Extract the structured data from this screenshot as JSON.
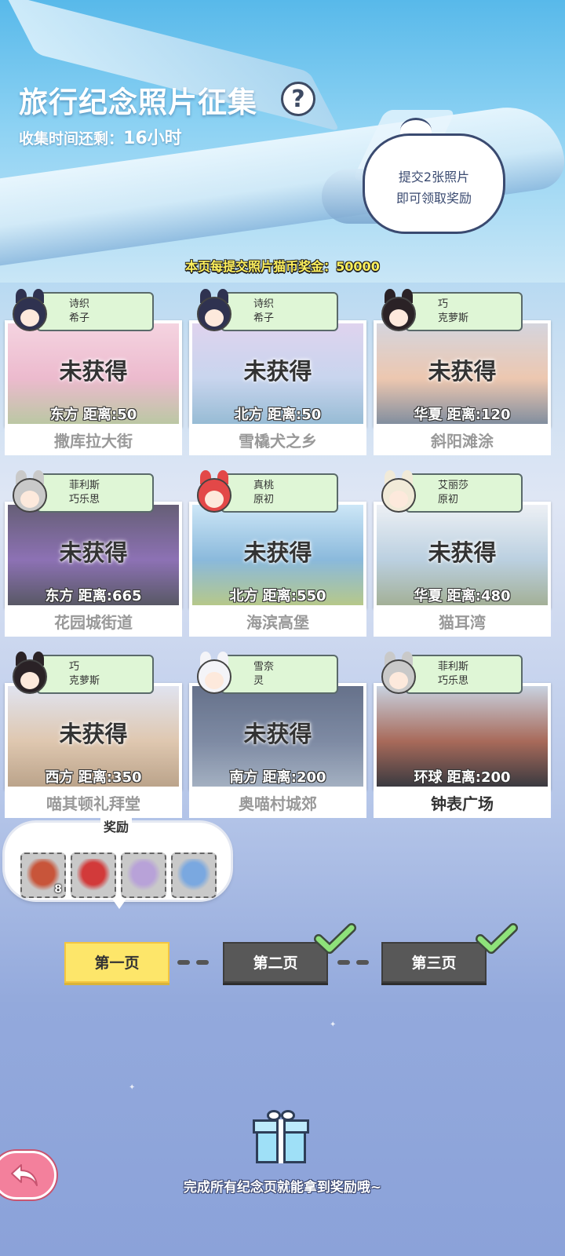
{
  "header": {
    "title": "旅行纪念照片征集",
    "help_icon": "?",
    "timer_label": "收集时间还剩：",
    "timer_value": "16小时",
    "speech_line1": "提交2张照片",
    "speech_line2": "即可领取奖励",
    "bonus_text": "本页每提交照片猫币奖金：50000"
  },
  "cards": [
    {
      "status": "未获得",
      "direction": "东方",
      "distance_label": "距离:50",
      "place": "撒库拉大街",
      "char_line1": "诗织",
      "char_line2": "希子",
      "scene_colors": [
        "#f2c8d8",
        "#e7a7c0",
        "#a8b88a"
      ],
      "hair": "#2f3250",
      "collected": false
    },
    {
      "status": "未获得",
      "direction": "北方",
      "distance_label": "距离:50",
      "place": "雪橇犬之乡",
      "char_line1": "诗织",
      "char_line2": "希子",
      "scene_colors": [
        "#d6c7ea",
        "#b9c9e9",
        "#7aa9c9"
      ],
      "hair": "#2f3250",
      "collected": false
    },
    {
      "status": "未获得",
      "direction": "华夏",
      "distance_label": "距离:120",
      "place": "斜阳滩涂",
      "char_line1": "巧",
      "char_line2": "克萝斯",
      "scene_colors": [
        "#c9c9d4",
        "#e8b89a",
        "#5f6f84"
      ],
      "hair": "#2a2226",
      "collected": false
    },
    {
      "status": "未获得",
      "direction": "东方",
      "distance_label": "距离:665",
      "place": "花园城街道",
      "char_line1": "菲利斯",
      "char_line2": "巧乐思",
      "scene_colors": [
        "#3b3250",
        "#6d4aa0",
        "#2a2a3a"
      ],
      "hair": "#c9c9c9",
      "collected": false
    },
    {
      "status": "未获得",
      "direction": "北方",
      "distance_label": "距离:550",
      "place": "海滨高堡",
      "char_line1": "真桃",
      "char_line2": "原初",
      "scene_colors": [
        "#bfe0f5",
        "#6aa6d2",
        "#a2b96a"
      ],
      "hair": "#e34848",
      "collected": false
    },
    {
      "status": "未获得",
      "direction": "华夏",
      "distance_label": "距离:480",
      "place": "猫耳湾",
      "char_line1": "艾丽莎",
      "char_line2": "原初",
      "scene_colors": [
        "#e8ecf2",
        "#a8c3d8",
        "#8a9a7a"
      ],
      "hair": "#f1ead8",
      "collected": false
    },
    {
      "status": "未获得",
      "direction": "西方",
      "distance_label": "距离:350",
      "place": "喵其顿礼拜堂",
      "char_line1": "巧",
      "char_line2": "克萝斯",
      "scene_colors": [
        "#d8dcec",
        "#d6b89a",
        "#a88a6a"
      ],
      "hair": "#2a2226",
      "collected": false
    },
    {
      "status": "未获得",
      "direction": "南方",
      "distance_label": "距离:200",
      "place": "奥喵村城郊",
      "char_line1": "雪奈",
      "char_line2": "灵",
      "scene_colors": [
        "#3b4a6a",
        "#5a6a8a",
        "#8a9ab0"
      ],
      "hair": "#f4f4f8",
      "collected": false
    },
    {
      "status": "",
      "direction": "环球",
      "distance_label": "距离:200",
      "place": "钟表广场",
      "char_line1": "菲利斯",
      "char_line2": "巧乐思",
      "scene_colors": [
        "#c8d2e0",
        "#a86a5a",
        "#3a3a40"
      ],
      "hair": "#c9c9c9",
      "collected": true
    }
  ],
  "reward": {
    "title": "奖励",
    "items": [
      {
        "icon": "basket-icon",
        "count": "8",
        "color": "#c8553a"
      },
      {
        "icon": "garland-icon",
        "count": "",
        "color": "#d23a3a"
      },
      {
        "icon": "stocking-icon",
        "count": "",
        "color": "#b8a2d8"
      },
      {
        "icon": "dress-icon",
        "count": "",
        "color": "#7aa8e0"
      }
    ]
  },
  "pages": [
    {
      "label": "第一页",
      "state": "active"
    },
    {
      "label": "第二页",
      "state": "done"
    },
    {
      "label": "第三页",
      "state": "done"
    }
  ],
  "footer_text": "完成所有纪念页就能拿到奖励哦~",
  "colors": {
    "accent_yellow": "#fde66a",
    "check_green": "#8ee27a",
    "back_pink": "#f3809c"
  }
}
